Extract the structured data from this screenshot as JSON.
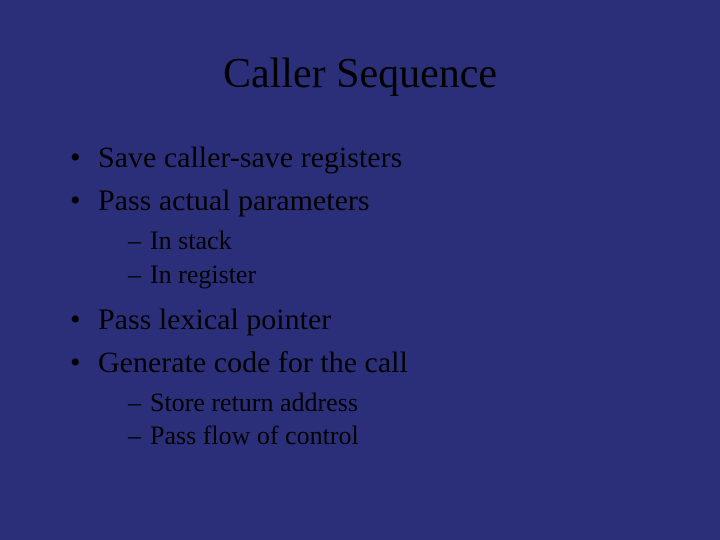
{
  "title": "Caller Sequence",
  "bullets": [
    {
      "text": "Save caller-save registers",
      "sub": []
    },
    {
      "text": "Pass actual parameters",
      "sub": [
        "In stack",
        "In register"
      ]
    },
    {
      "text": "Pass lexical pointer",
      "sub": []
    },
    {
      "text": "Generate code for the call",
      "sub": [
        "Store return address",
        "Pass flow of control"
      ]
    }
  ]
}
